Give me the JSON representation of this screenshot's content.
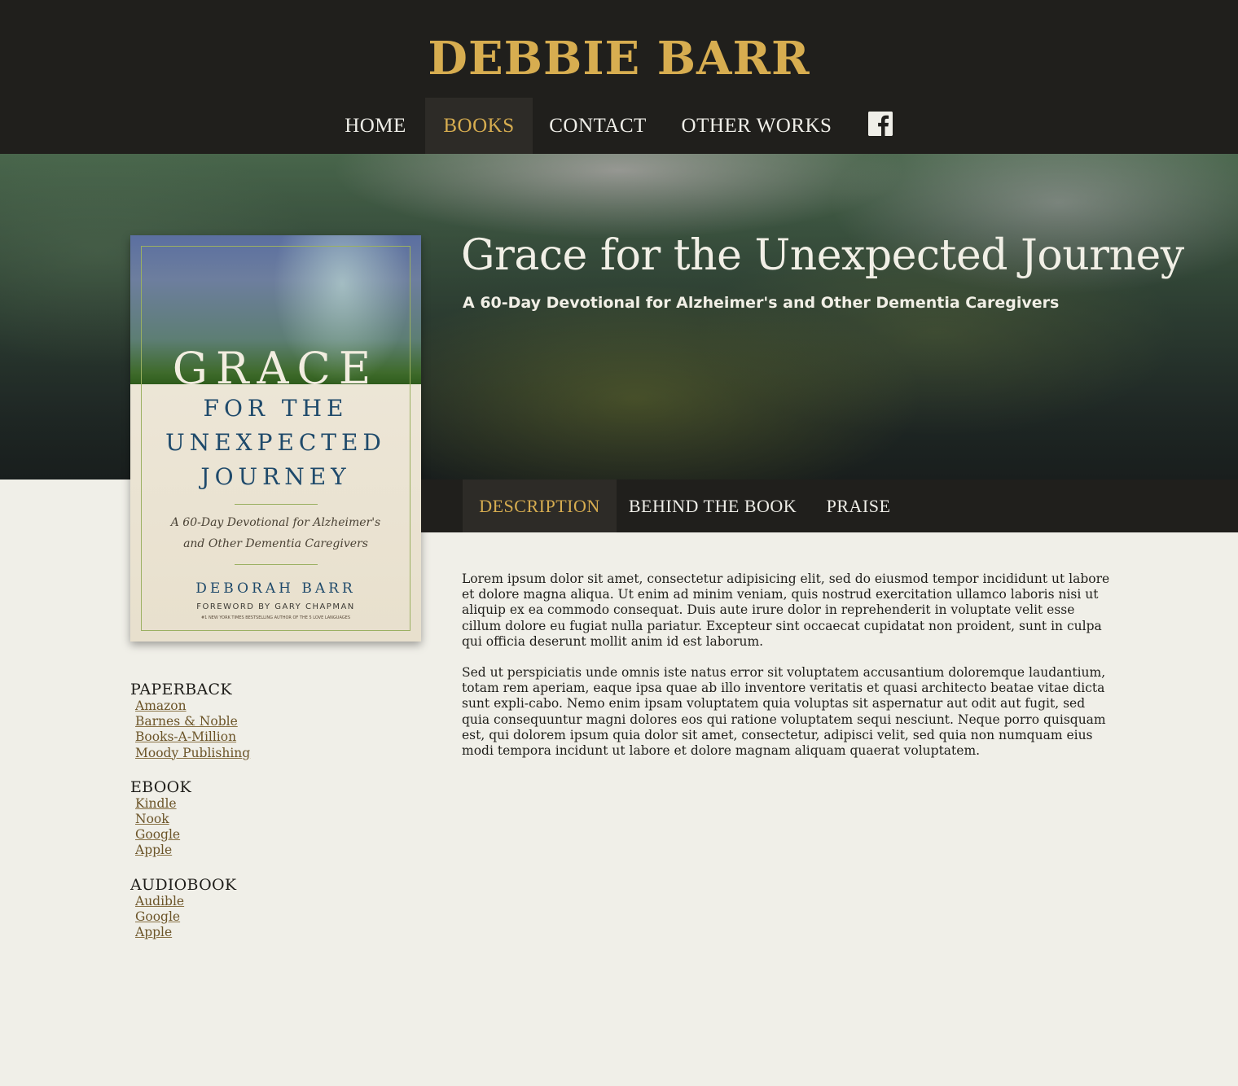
{
  "site": {
    "title": "DEBBIE BARR",
    "nav": [
      "HOME",
      "BOOKS",
      "CONTACT",
      "OTHER WORKS"
    ],
    "active_nav": "BOOKS",
    "social_icon": "facebook-icon"
  },
  "book": {
    "title": "Grace for the Unexpected Journey",
    "subtitle": "A 60-Day Devotional for Alzheimer's and Other Dementia Caregivers"
  },
  "cover": {
    "grace": "GRACE",
    "line1": "FOR THE",
    "line2": "UNEXPECTED",
    "line3": "JOURNEY",
    "tagline1": "A 60-Day Devotional for Alzheimer's",
    "tagline2": "and Other Dementia Caregivers",
    "author": "DEBORAH BARR",
    "foreword": "FOREWORD BY GARY CHAPMAN",
    "small": "#1 NEW YORK TIMES BESTSELLING AUTHOR OF THE 5 LOVE LANGUAGES"
  },
  "tabs": [
    "DESCRIPTION",
    "BEHIND THE BOOK",
    "PRAISE"
  ],
  "active_tab": "DESCRIPTION",
  "description": [
    "Lorem ipsum dolor sit amet, consectetur adipisicing elit, sed do eiusmod tempor incididunt ut labore et dolore magna aliqua. Ut enim ad minim veniam, quis nostrud exercitation ullamco laboris nisi ut aliquip ex ea commodo consequat. Duis aute irure dolor in reprehenderit in voluptate velit esse cillum dolore eu fugiat nulla pariatur. Excepteur sint occaecat cupidatat non proident, sunt in culpa qui officia deserunt mollit anim id est laborum.",
    "Sed ut perspiciatis unde omnis iste natus error sit voluptatem accusantium doloremque laudantium, totam rem aperiam, eaque ipsa quae ab illo inventore veritatis et quasi architecto beatae vitae dicta sunt expli-cabo. Nemo enim ipsam voluptatem quia voluptas sit aspernatur aut odit aut fugit, sed quia consequuntur magni dolores eos qui ratione voluptatem sequi nesciunt. Neque porro quisquam est, qui dolorem ipsum quia dolor sit amet, consectetur, adipisci velit, sed quia non numquam eius modi tempora incidunt ut labore et dolore magnam aliquam quaerat voluptatem."
  ],
  "buy": [
    {
      "heading": "PAPERBACK",
      "links": [
        "Amazon",
        "Barnes & Noble",
        "Books-A-Million",
        "Moody Publishing"
      ]
    },
    {
      "heading": "EBOOK",
      "links": [
        "Kindle",
        "Nook",
        "Google",
        "Apple"
      ]
    },
    {
      "heading": "AUDIOBOOK",
      "links": [
        "Audible",
        "Google",
        "Apple"
      ]
    }
  ],
  "colors": {
    "accent": "#d7ad50",
    "header_bg": "#201f1c",
    "page_bg": "#f0efe8",
    "link": "#6b5428"
  }
}
